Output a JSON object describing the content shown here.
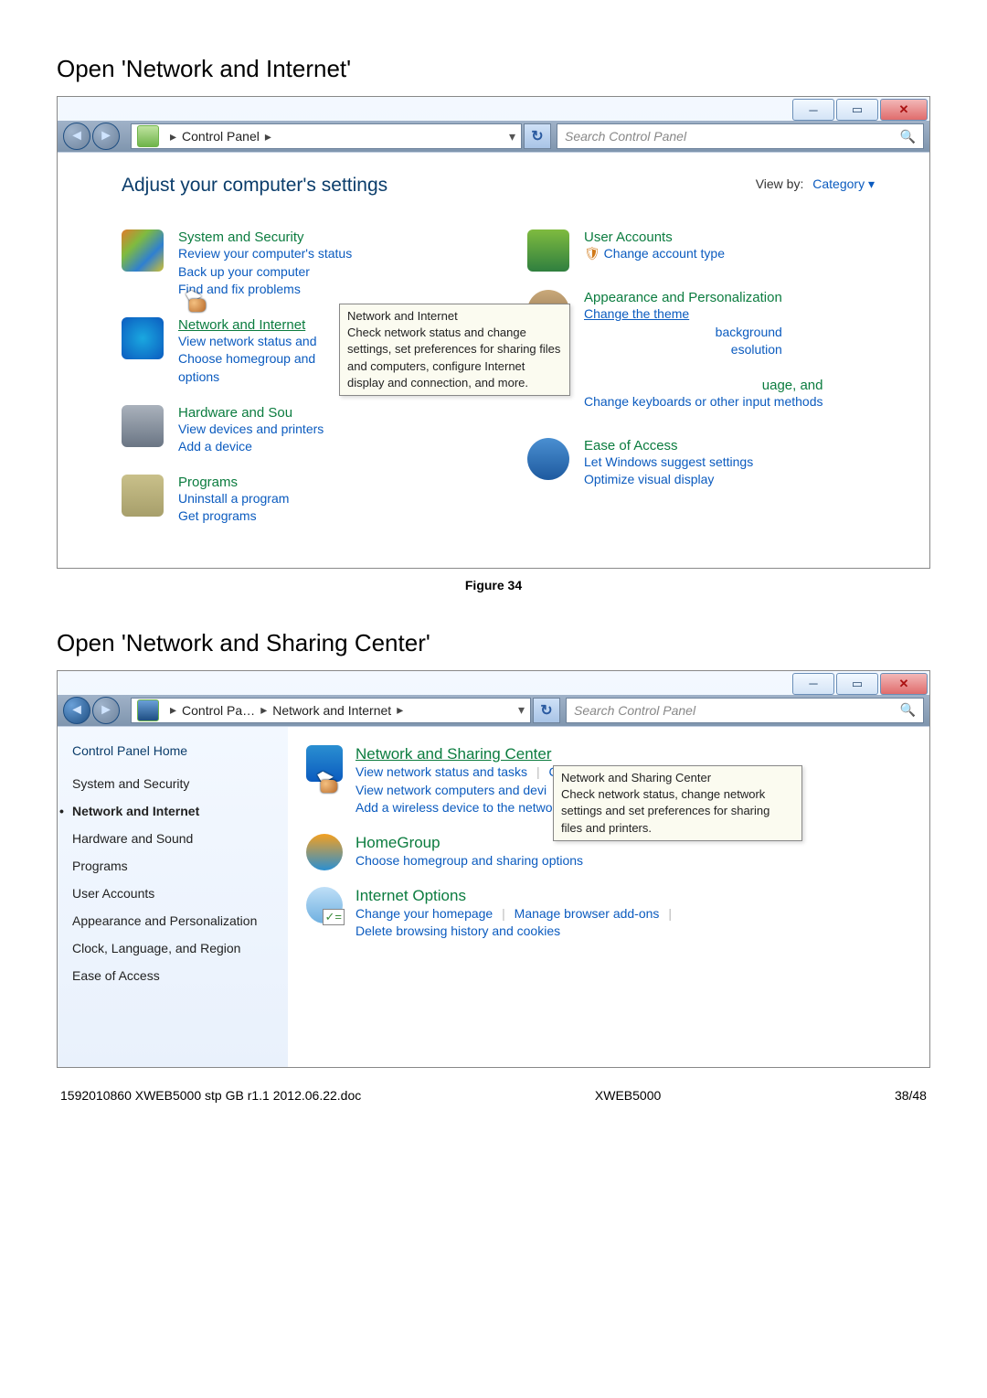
{
  "headings": {
    "h1": "Open 'Network and Internet'",
    "h2": "Open 'Network and Sharing Center'"
  },
  "fig1": {
    "breadcrumb": "Control Panel",
    "search_placeholder": "Search Control Panel",
    "adjust": "Adjust your computer's settings",
    "viewby": "View by:",
    "viewby_val": "Category",
    "left": [
      {
        "title": "System and Security",
        "links": [
          "Review your computer's status",
          "Back up your computer",
          "Find and fix problems"
        ]
      },
      {
        "title": "Network and Internet",
        "title_u": true,
        "links": [
          "View network status and",
          "Choose homegroup and",
          "options"
        ]
      },
      {
        "title": "Hardware and Sou",
        "links": [
          "View devices and printers",
          "Add a device"
        ]
      },
      {
        "title": "Programs",
        "links": [
          "Uninstall a program",
          "Get programs"
        ]
      }
    ],
    "right": [
      {
        "title": "User Accounts",
        "links": [
          "Change account type"
        ]
      },
      {
        "title": "Appearance and Personalization",
        "links": [
          "Change the theme",
          "background",
          "esolution"
        ]
      },
      {
        "title_frag": "uage, and",
        "links": [
          "Change keyboards or other input methods"
        ]
      },
      {
        "title": "Ease of Access",
        "links": [
          "Let Windows suggest settings",
          "Optimize visual display"
        ]
      }
    ],
    "tooltip": {
      "title": "Network and Internet",
      "body": "Check network status and change settings, set preferences for sharing files and computers, configure Internet display and connection, and more."
    },
    "caption": "Figure 34"
  },
  "fig2": {
    "breadcrumb1": "Control Pa…",
    "breadcrumb2": "Network and Internet",
    "search_placeholder": "Search Control Panel",
    "sidebar": {
      "home": "Control Panel Home",
      "items": [
        "System and Security",
        "Network and Internet",
        "Hardware and Sound",
        "Programs",
        "User Accounts",
        "Appearance and Personalization",
        "Clock, Language, and Region",
        "Ease of Access"
      ]
    },
    "main": {
      "nsc": {
        "title": "Network and Sharing Center",
        "l1": "View network status and tasks",
        "l2": "Connect to a network",
        "l3": "View network computers and devi",
        "l4": "Add a wireless device to the netwo"
      },
      "hg": {
        "title": "HomeGroup",
        "l1": "Choose homegroup and sharing options"
      },
      "io": {
        "title": "Internet Options",
        "l1": "Change your homepage",
        "l2": "Manage browser add-ons",
        "l3": "Delete browsing history and cookies"
      },
      "tooltip": "Network and Sharing Center\nCheck network status, change network settings and set preferences for sharing files and printers."
    }
  },
  "footer": {
    "left": "1592010860 XWEB5000 stp GB r1.1 2012.06.22.doc",
    "center": "XWEB5000",
    "right": "38/48"
  }
}
